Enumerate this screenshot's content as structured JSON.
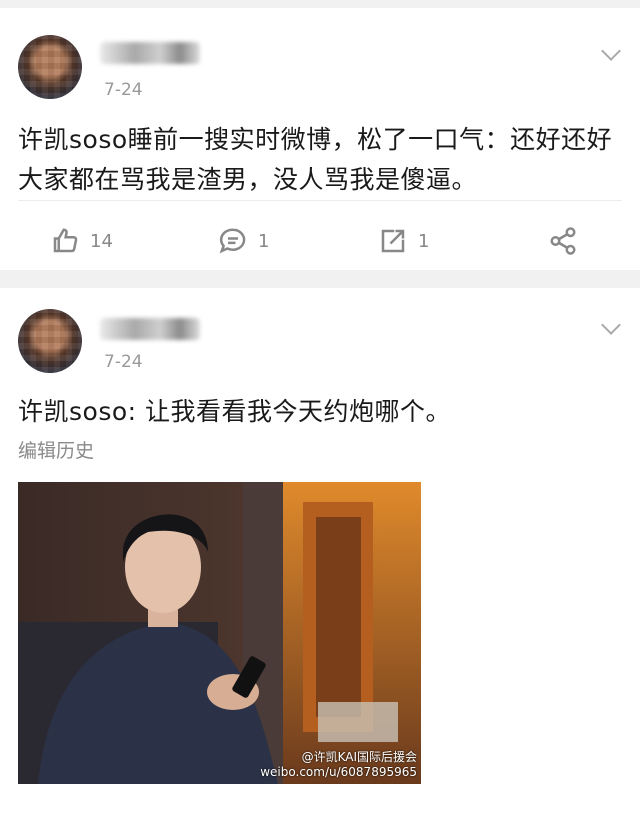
{
  "posts": [
    {
      "date": "7-24",
      "text_line1": "许凯soso睡前一搜实时微博，松了一口气：还好还好",
      "text_line2": "大家都在骂我是渣男，没人骂我是傻逼。",
      "likes": "14",
      "comments": "1",
      "reposts": "1"
    },
    {
      "date": "7-24",
      "text": "许凯soso: 让我看看我今天约炮哪个。",
      "edit_history": "编辑历史",
      "watermark_line1": "@许凯KAI国际后援会",
      "watermark_line2": "weibo.com/u/6087895965"
    }
  ],
  "icons": [
    "chevron-down-icon",
    "thumbs-up-icon",
    "comment-icon",
    "repost-icon",
    "share-icon",
    "weibo-logo-icon"
  ]
}
